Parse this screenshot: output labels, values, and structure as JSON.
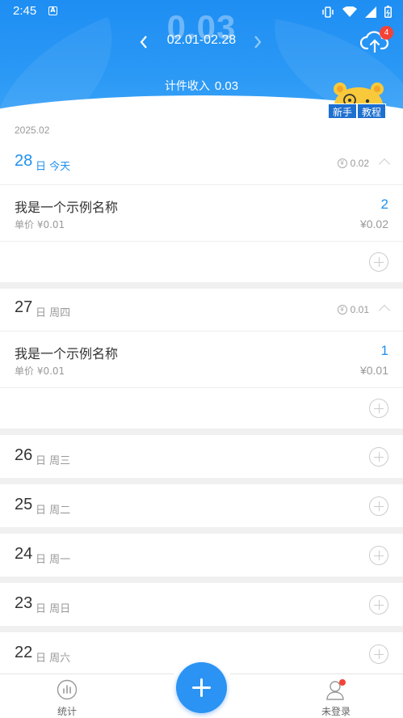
{
  "status_bar": {
    "time": "2:45",
    "app_icon": "A"
  },
  "header": {
    "big_total": "0.03",
    "period": "02.01-02.28",
    "income_label": "计件收入",
    "income_value": "0.03",
    "sync_badge": "4",
    "tutorial_labels": [
      "新手",
      "教程"
    ]
  },
  "month_label": "2025.02",
  "days": [
    {
      "day": "28",
      "label": "日 今天",
      "sum": "0.02",
      "today": true,
      "items": [
        {
          "name": "我是一个示例名称",
          "unit_price": "单价 ¥0.01",
          "qty": "2",
          "total": "¥0.02"
        }
      ]
    },
    {
      "day": "27",
      "label": "日 周四",
      "sum": "0.01",
      "items": [
        {
          "name": "我是一个示例名称",
          "unit_price": "单价 ¥0.01",
          "qty": "1",
          "total": "¥0.01"
        }
      ]
    }
  ],
  "collapsed_days": [
    {
      "day": "26",
      "label": "日 周三"
    },
    {
      "day": "25",
      "label": "日 周二"
    },
    {
      "day": "24",
      "label": "日 周一"
    },
    {
      "day": "23",
      "label": "日 周日"
    },
    {
      "day": "22",
      "label": "日 周六"
    }
  ],
  "nav": {
    "stats_label": "统计",
    "user_label": "未登录"
  },
  "colors": {
    "primary": "#1e90f0",
    "header_top": "#1e8ef3",
    "badge": "#f44336"
  }
}
